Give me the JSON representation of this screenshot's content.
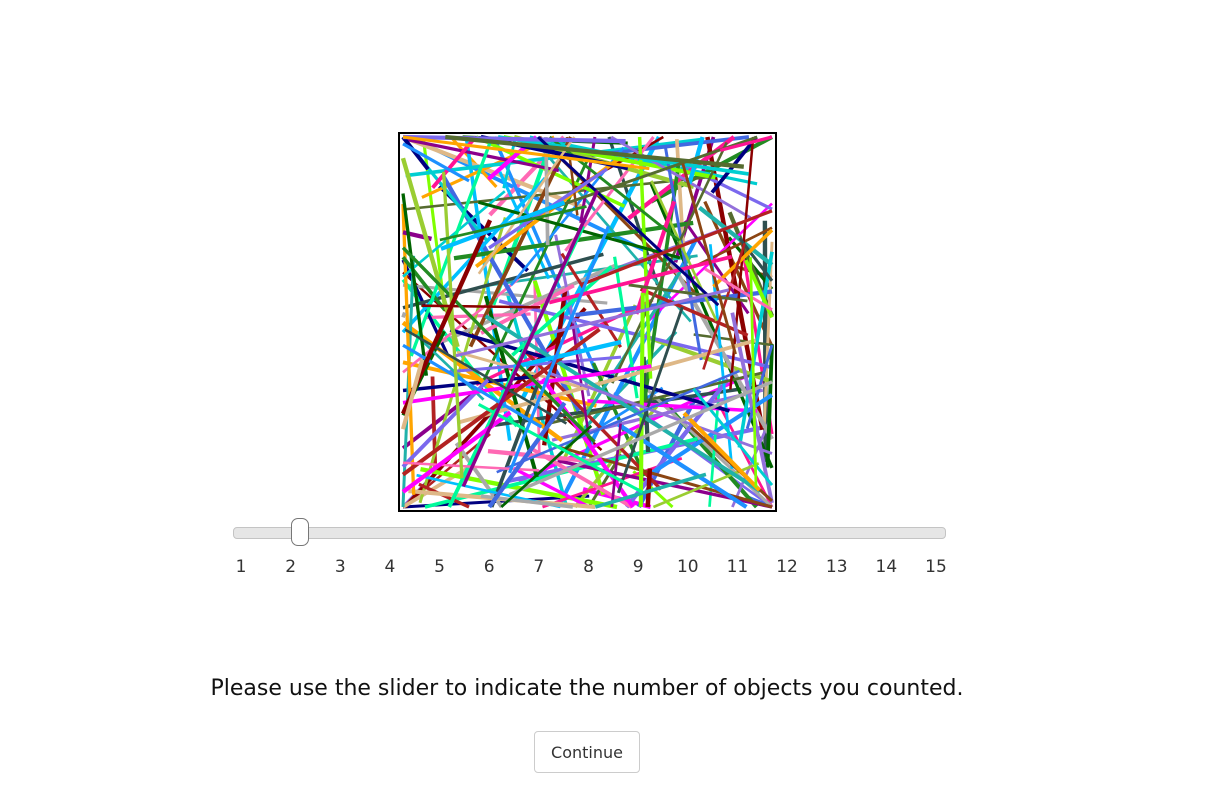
{
  "stimulus": {
    "description_name": "random-lines-stimulus",
    "line_colors": [
      "#1e90ff",
      "#228b22",
      "#8b008b",
      "#ff69b4",
      "#7fff00",
      "#20b2aa",
      "#8b4513",
      "#000080",
      "#9acd32",
      "#ff1493",
      "#2f4f4f",
      "#9370db",
      "#ffa500",
      "#00ced1",
      "#8b0000",
      "#a9a9a9",
      "#ff00ff",
      "#006400",
      "#4169e1",
      "#deb887",
      "#7b68ee",
      "#00fa9a",
      "#b22222",
      "#00bfff",
      "#556b2f"
    ]
  },
  "slider": {
    "min": 1,
    "max": 15,
    "value": 2,
    "tick_labels": [
      "1",
      "2",
      "3",
      "4",
      "5",
      "6",
      "7",
      "8",
      "9",
      "10",
      "11",
      "12",
      "13",
      "14",
      "15"
    ]
  },
  "prompt": {
    "text": "Please use the slider to indicate the number of objects you counted."
  },
  "continue_button": {
    "label": "Continue"
  }
}
